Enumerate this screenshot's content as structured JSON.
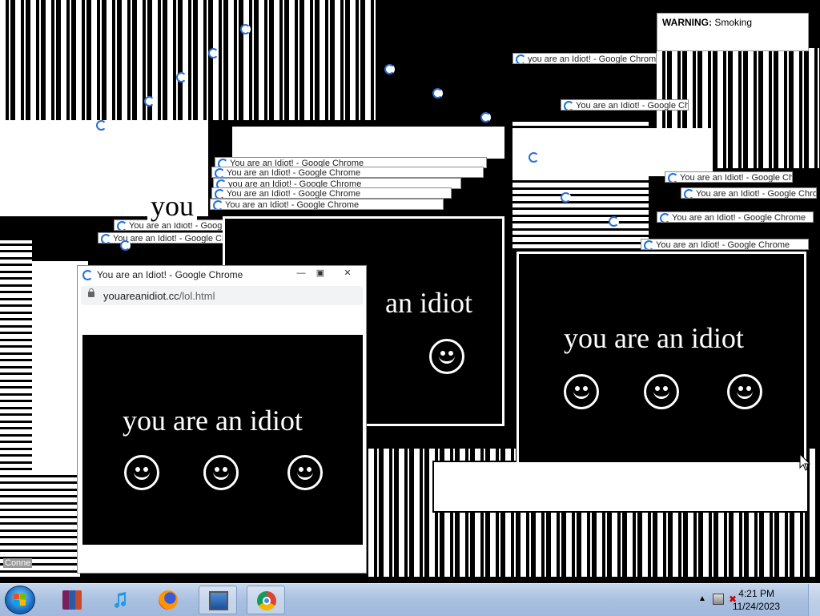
{
  "warning": {
    "label": "WARNING:",
    "text": "Smoking"
  },
  "trail_title": "You are an Idiot! - Google Chrome",
  "trail_titles": [
    "You are an Idiot! - Google Chrome",
    "You are an Idiot! - Google Chrome",
    "you are an Idiot! - Google Chrome",
    "You are an Idiot! - Google Chrome",
    "You are an Idiot! - Google Chrome",
    "You are an Idiot! - Google Chrome",
    "You are an Idiot! - Google Chrome",
    "you are an Idiot! - Google Chrome",
    "You are an Idiot! - Google Chrome",
    "You are an Idiot! - Google Chrome",
    "You are an Idiot! - Google Chrome",
    "You are an Idiot! - Google Chrome",
    "You are an Idiot! - Google Chrome"
  ],
  "main_window": {
    "title": "You are an Idiot! - Google Chrome",
    "url_domain": "youareanidiot.cc",
    "url_path": "/lol.html",
    "message": "you are an idiot"
  },
  "bg_window_right": {
    "message": "you are an idiot"
  },
  "bg_window_center": {
    "message": "an idiot"
  },
  "bg_fragment_you": "you",
  "bg_fragment_y": "y",
  "connection_text": "Conne",
  "taskbar": {
    "icons": [
      "winrar-icon",
      "itunes-icon",
      "firefox-icon",
      "remote-desktop-icon",
      "chrome-icon"
    ],
    "clock_time": "4:21 PM",
    "clock_date": "11/24/2023"
  }
}
